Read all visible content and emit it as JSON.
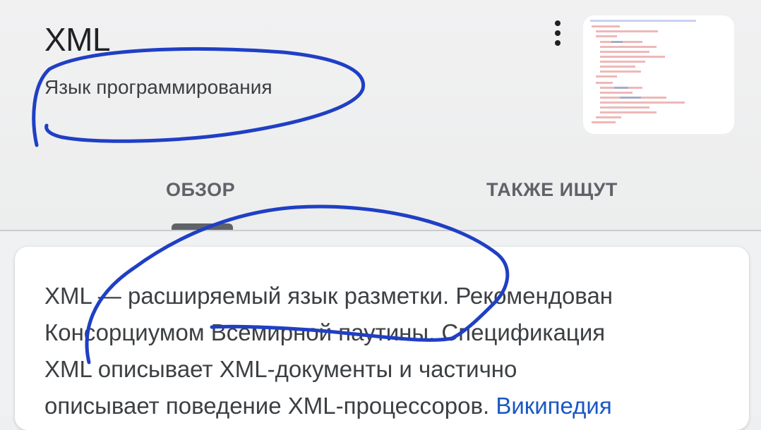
{
  "header": {
    "title": "XML",
    "subtitle": "Язык программирования",
    "menu_icon": "more-vert-icon"
  },
  "thumbnail": {
    "icon": "xml-code-thumbnail"
  },
  "tabs": [
    {
      "label": "ОБЗОР",
      "active": true
    },
    {
      "label": "ТАКЖЕ ИЩУТ",
      "active": false
    }
  ],
  "summary": {
    "lines": [
      "XML — расширяемый язык разметки. Рекомендован",
      "Консорциумом Всемирной паутины. Спецификация",
      "XML описывает XML-документы и частично",
      "описывает поведение XML-процессоров. "
    ],
    "source_label": "Википедия"
  },
  "colors": {
    "annotation_ink": "#1f3fc4",
    "link": "#1a58c4",
    "text": "#3c4043",
    "tab_indicator": "#5f6368"
  }
}
